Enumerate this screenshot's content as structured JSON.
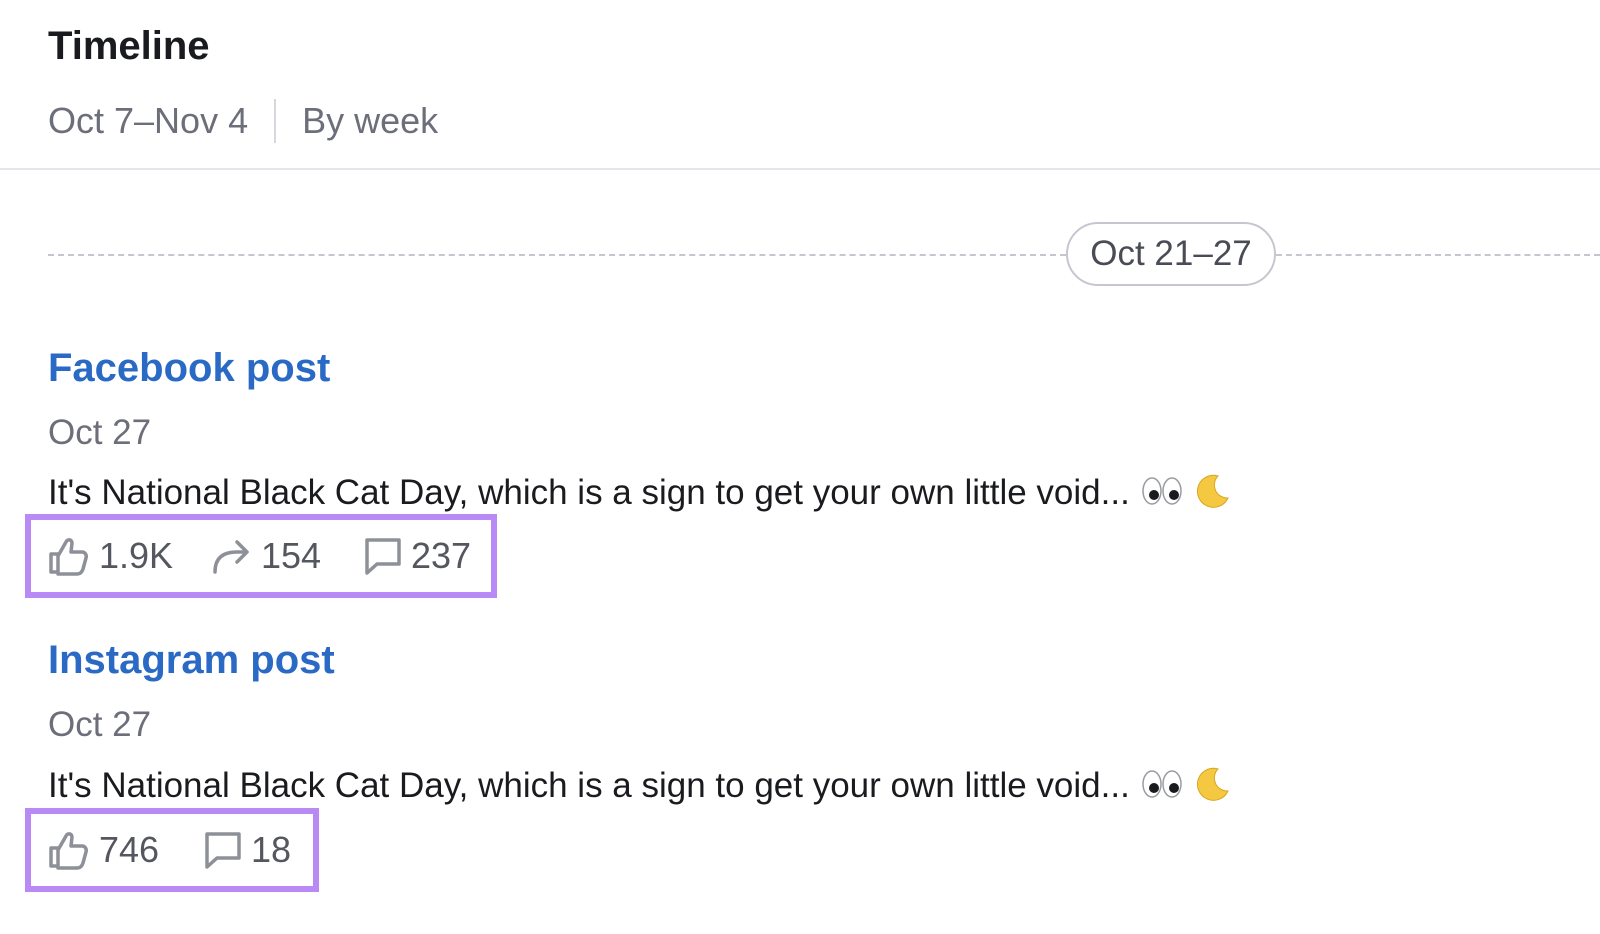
{
  "header": {
    "title": "Timeline",
    "date_range": "Oct 7–Nov 4",
    "grouping": "By week"
  },
  "week_separator": {
    "label": "Oct 21–27"
  },
  "posts": [
    {
      "title": "Facebook post",
      "date": "Oct 27",
      "text": "It's National Black Cat Day, which is a sign to get your own little void...",
      "emojis": [
        "eyes-emoji",
        "crescent-moon-emoji"
      ],
      "stats": {
        "likes": "1.9K",
        "shares": "154",
        "comments": "237"
      }
    },
    {
      "title": "Instagram post",
      "date": "Oct 27",
      "text": "It's National Black Cat Day, which is a sign to get your own little void...",
      "emojis": [
        "eyes-emoji",
        "crescent-moon-emoji"
      ],
      "stats": {
        "likes": "746",
        "comments": "18"
      }
    }
  ],
  "colors": {
    "post_title": "#2a6ac4",
    "highlight_box": "#b98af5",
    "muted_text": "#6c6e79",
    "icon": "#8e9099"
  }
}
